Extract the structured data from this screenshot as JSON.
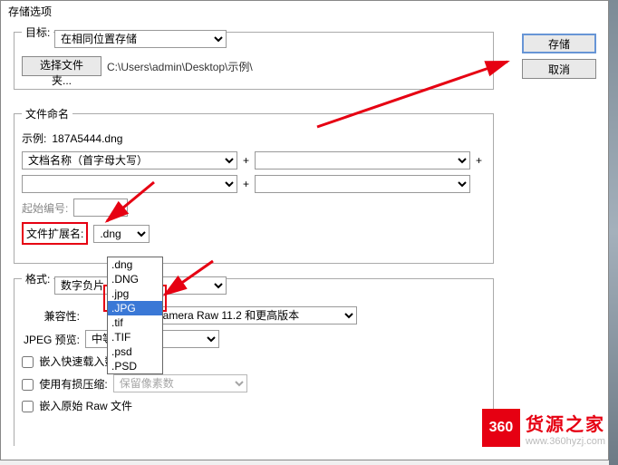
{
  "title": "存储选项",
  "buttons": {
    "save": "存储",
    "cancel": "取消",
    "choose_folder": "选择文件夹..."
  },
  "target": {
    "legend": "目标:",
    "location_selected": "在相同位置存储",
    "path": "C:\\Users\\admin\\Desktop\\示例\\"
  },
  "naming": {
    "legend": "文件命名",
    "example_label": "示例:",
    "example_value": "187A5444.dng",
    "seg1": "文档名称（首字母大写）",
    "seg2": "",
    "seg3": "",
    "seg4": "",
    "start_num_label": "起始编号:",
    "start_num_value": "",
    "ext_label": "文件扩展名:",
    "ext_selected": ".dng",
    "ext_options": [
      ".dng",
      ".DNG",
      ".jpg",
      ".JPG",
      ".tif",
      ".TIF",
      ".psd",
      ".PSD"
    ]
  },
  "format": {
    "legend": "格式:",
    "format_selected": "数字负片",
    "compat_label": "兼容性:",
    "compat_selected": "Camera Raw 11.2 和更高版本",
    "jpeg_preview_label": "JPEG 预览:",
    "jpeg_preview_selected": "中等大小",
    "cb_fastload": "嵌入快速载入数据",
    "cb_lossy_label": "使用有损压缩:",
    "lossy_selected": "保留像素数",
    "cb_embed_raw": "嵌入原始 Raw 文件"
  },
  "watermark": {
    "logo": "360",
    "name": "货源之家",
    "url": "www.360hyzj.com"
  }
}
